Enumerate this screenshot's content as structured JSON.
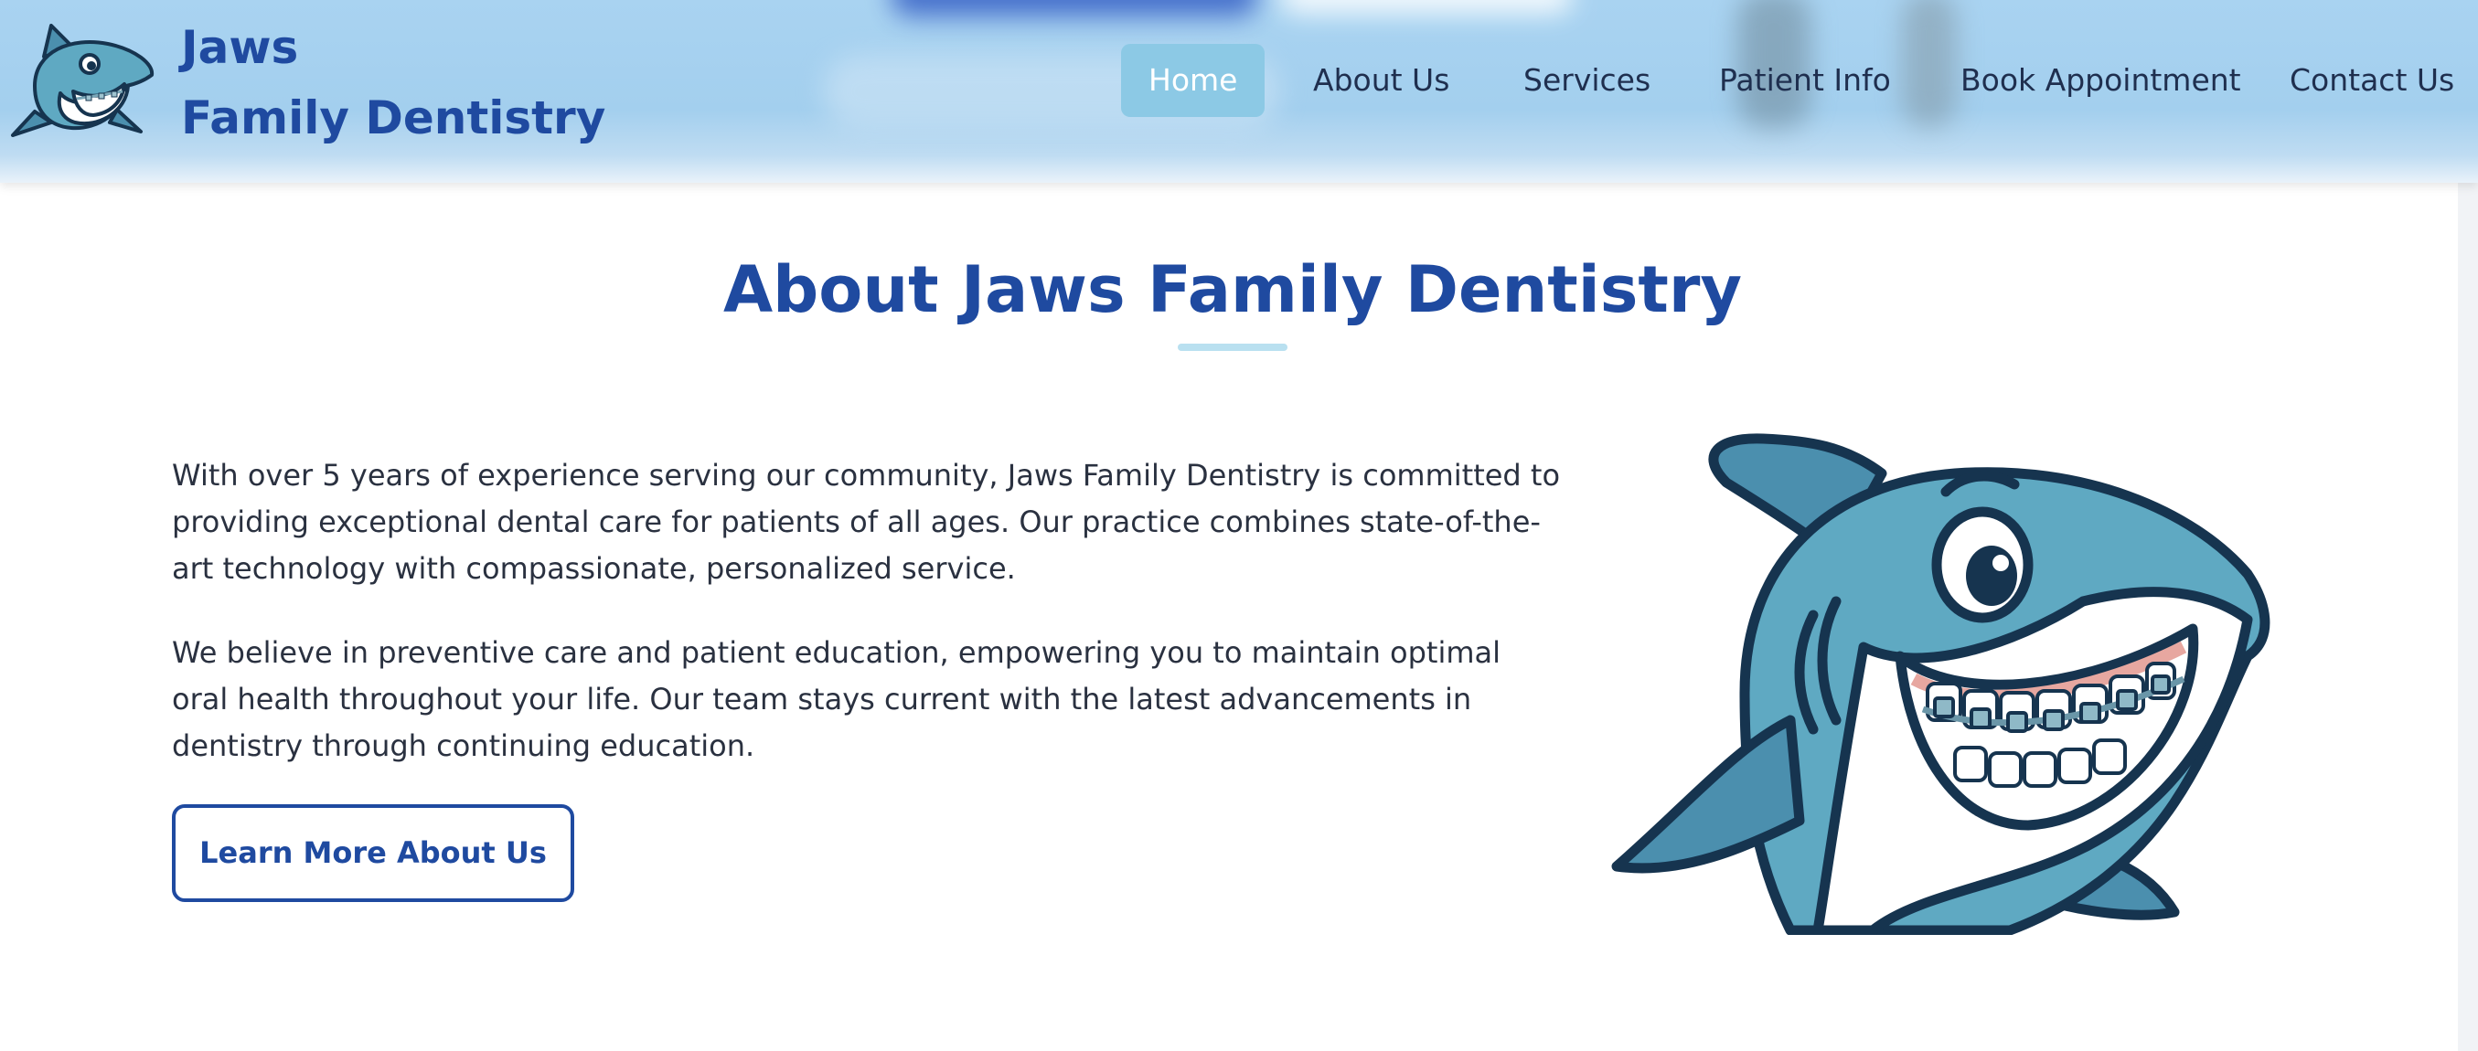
{
  "header": {
    "brand_line1": "Jaws",
    "brand_line2": "Family Dentistry",
    "logo": "shark-mascot-logo"
  },
  "nav": {
    "items": [
      {
        "label": "Home",
        "active": true
      },
      {
        "label": "About Us",
        "active": false
      },
      {
        "label": "Services",
        "active": false
      },
      {
        "label": "Patient Info",
        "active": false
      },
      {
        "label": "Book Appointment",
        "active": false
      },
      {
        "label": "Contact Us",
        "active": false
      }
    ]
  },
  "about": {
    "title": "About Jaws Family Dentistry",
    "paragraph1": "With over 5 years of experience serving our community, Jaws Family Dentistry is committed to providing exceptional dental care for patients of all ages. Our practice combines state-of-the-art technology with compassionate, personalized service.",
    "paragraph2": "We believe in preventive care and patient education, empowering you to maintain optimal oral health throughout your life. Our team stays current with the latest advancements in dentistry through continuing education.",
    "button_label": "Learn More About Us",
    "image": "smiling-shark-with-braces-illustration"
  },
  "colors": {
    "brand_blue": "#1f4aa0",
    "header_bg": "#a3cfee",
    "nav_active_bg": "#8cc9e5",
    "shark_body": "#5fa9c2",
    "shark_outline": "#16344f",
    "title_rule": "#b9e0f0"
  }
}
